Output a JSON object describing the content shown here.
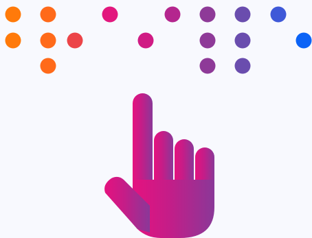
{
  "theme": {
    "background": "#F8F9FE"
  },
  "braille": {
    "cells": [
      {
        "dots": [
          1,
          2
        ],
        "color_top": "#FF7A0A",
        "color_bottom": "#FF7A0A"
      },
      {
        "dots": [
          1,
          2,
          3
        ],
        "color_top": "#FF6A1A",
        "color_bottom": "#FF6A1A"
      },
      {
        "dots": [
          5
        ],
        "color_top": "#EC4448",
        "color_bottom": "#EC4448"
      },
      {
        "dots": [
          1
        ],
        "color_top": "#E2187E",
        "color_bottom": "#E2187E"
      },
      {
        "dots": [
          5
        ],
        "color_top": "#D01B84",
        "color_bottom": "#D01B84"
      },
      {
        "dots": [
          1
        ],
        "color_top": "#B4268E",
        "color_bottom": "#B4268E"
      },
      {
        "dots": [
          1,
          2,
          3
        ],
        "color_top": "#8E3A98",
        "color_bottom": "#8E3A98"
      },
      {
        "dots": [
          1,
          2,
          3
        ],
        "color_top": "#6A4DAE",
        "color_bottom": "#6A4DAE"
      },
      {
        "dots": [
          1
        ],
        "color_top": "#3F59D8",
        "color_bottom": "#3F59D8"
      },
      {
        "dots": [
          5
        ],
        "color_top": "#0B63F6",
        "color_bottom": "#0B63F6"
      }
    ]
  },
  "hand": {
    "icon": "pointing-hand-icon",
    "gradient_start": "#E5127F",
    "gradient_mid": "#C41D88",
    "gradient_end": "#8A3898"
  }
}
